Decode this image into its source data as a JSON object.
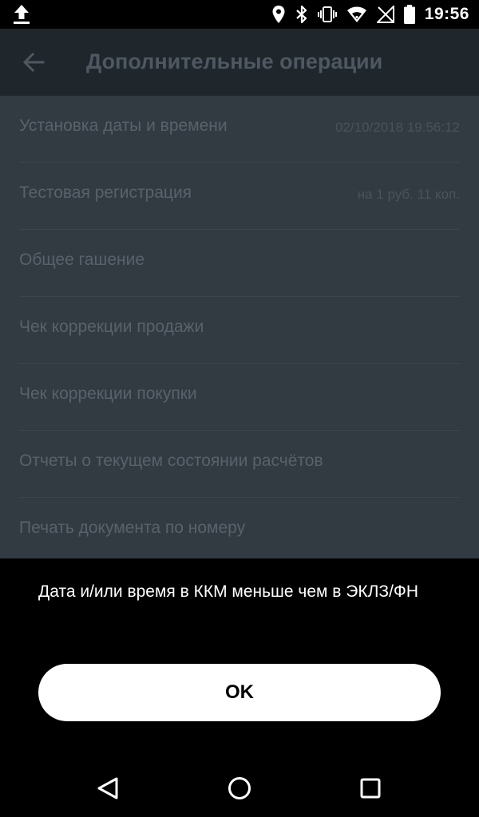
{
  "status_bar": {
    "time": "19:56",
    "icons": [
      "upload-icon",
      "location-icon",
      "bluetooth-icon",
      "vibrate-icon",
      "wifi-icon",
      "no-signal-icon",
      "battery-icon"
    ]
  },
  "app_bar": {
    "title": "Дополнительные операции",
    "back_icon": "arrow-left-icon"
  },
  "list": {
    "items": [
      {
        "label": "Установка даты и времени",
        "value": "02/10/2018 19:56:12"
      },
      {
        "label": "Тестовая регистрация",
        "value": "на 1 руб. 11 коп."
      },
      {
        "label": "Общее гашение",
        "value": ""
      },
      {
        "label": "Чек коррекции продажи",
        "value": ""
      },
      {
        "label": "Чек коррекции покупки",
        "value": ""
      },
      {
        "label": "Отчеты о текущем состоянии расчётов",
        "value": ""
      },
      {
        "label": "Печать документа по номеру",
        "value": ""
      }
    ]
  },
  "dialog": {
    "message": "Дата и/или время в ККМ меньше чем в ЭКЛЗ/ФН",
    "ok_label": "OK"
  },
  "nav_bar": {
    "icons": [
      "nav-back-icon",
      "nav-home-icon",
      "nav-recents-icon"
    ]
  },
  "colors": {
    "list_background": "#323a42",
    "app_bar_background": "#1f262c",
    "dialog_background": "#000000",
    "button_background": "#ffffff"
  }
}
